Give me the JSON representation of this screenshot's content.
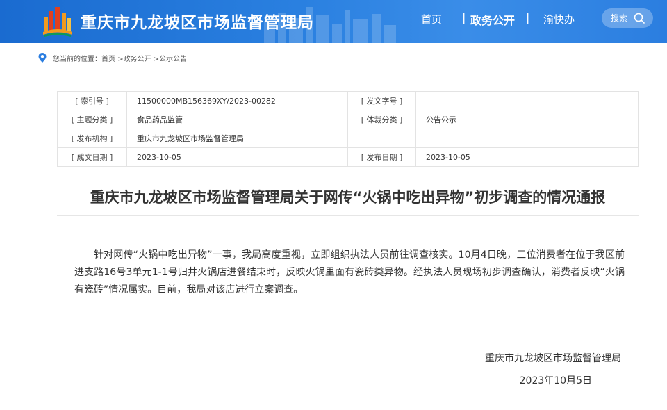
{
  "header": {
    "site_title": "重庆市九龙坡区市场监督管理局",
    "nav": {
      "home": "首页",
      "separator": "|",
      "gov_affairs": "政务公开",
      "yukuaiban": "渝快办"
    },
    "search_label": "搜索",
    "logo_icon": "city-logo-icon",
    "search_icon": "search-icon"
  },
  "breadcrumb": {
    "icon": "location-pin-icon",
    "prefix": "您当前的位置：",
    "items": [
      "首页",
      ">政务公开",
      ">公示公告"
    ]
  },
  "meta": {
    "rows": [
      {
        "k1": "[ 索引号 ]",
        "v1": "11500000MB156369XY/2023-00282",
        "k2": "[ 发文字号 ]",
        "v2": ""
      },
      {
        "k1": "[ 主题分类 ]",
        "v1": "食品药品监管",
        "k2": "[ 体裁分类 ]",
        "v2": "公告公示"
      },
      {
        "k1": "[ 发布机构 ]",
        "v1": "重庆市九龙坡区市场监督管理局",
        "k2": "",
        "v2": ""
      },
      {
        "k1": "[ 成文日期 ]",
        "v1": "2023-10-05",
        "k2": "[ 发布日期 ]",
        "v2": "2023-10-05"
      }
    ]
  },
  "article": {
    "title": "重庆市九龙坡区市场监督管理局关于网传“火锅中吃出异物”初步调查的情况通报",
    "body": "针对网传“火锅中吃出异物”一事，我局高度重视，立即组织执法人员前往调查核实。10月4日晚，三位消费者在位于我区前进支路16号3单元1-1号归井火锅店进餐结束时，反映火锅里面有瓷砖类异物。经执法人员现场初步调查确认，消费者反映“火锅有瓷砖”情况属实。目前，我局对该店进行立案调查。",
    "signature": "重庆市九龙坡区市场监督管理局",
    "date": "2023年10月5日"
  },
  "colors": {
    "header_blue": "#2a80e0",
    "accent_orange": "#f39b1f",
    "accent_red": "#e0401f"
  }
}
